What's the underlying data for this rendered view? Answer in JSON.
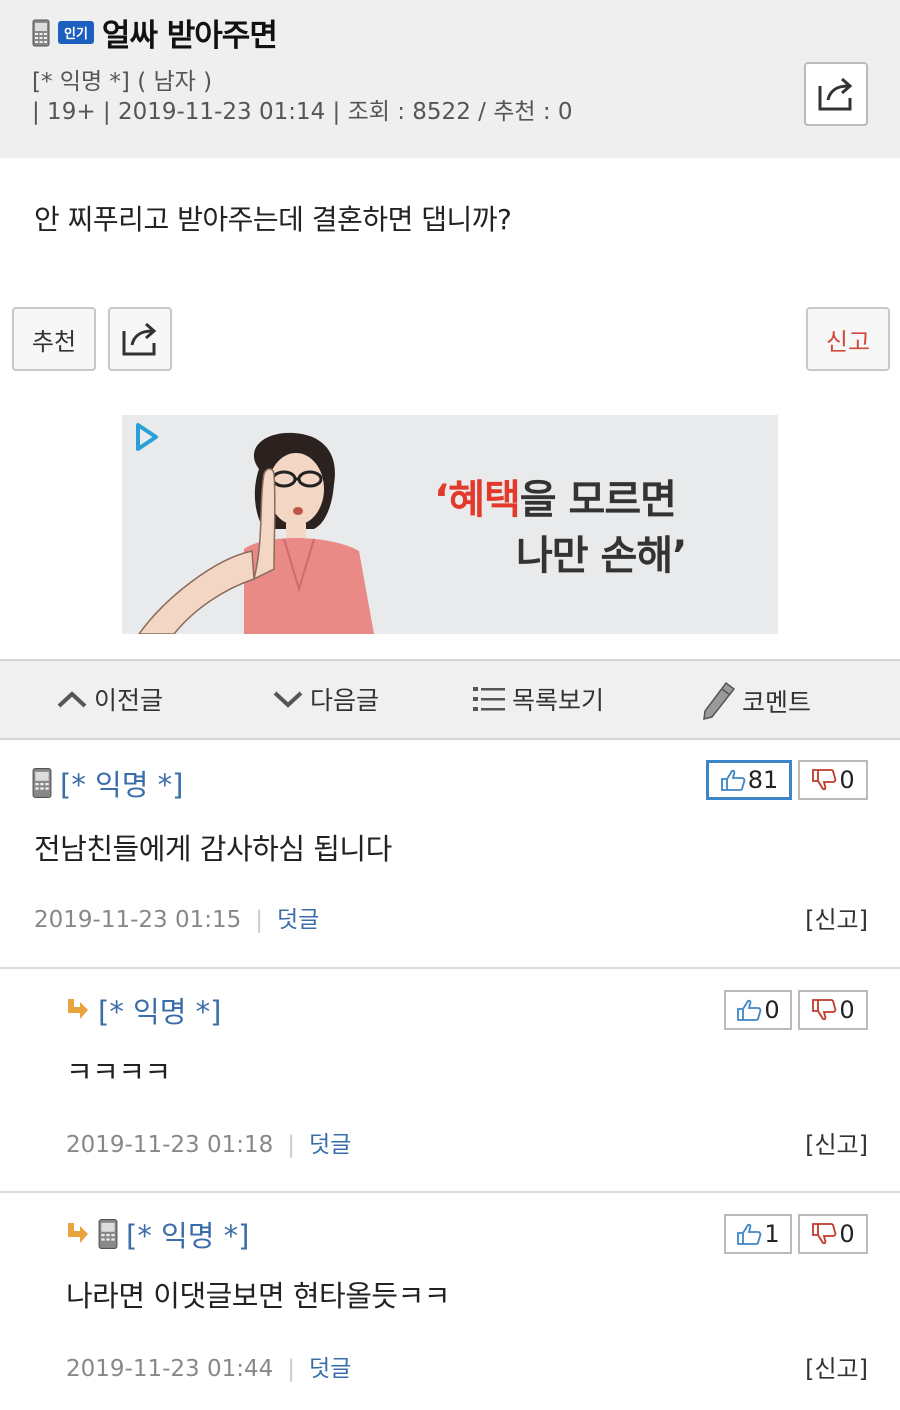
{
  "post": {
    "badge": "인기",
    "title": "얼싸 받아주면",
    "author_line": "[* 익명 *] ( 남자 )",
    "meta_line": "| 19+ | 2019-11-23 01:14 | 조회 : 8522 / 추천 : 0",
    "body": "안 찌푸리고 받아주는데 결혼하면 댑니까?"
  },
  "actions": {
    "recommend_label": "추천",
    "report_label": "신고"
  },
  "ad": {
    "line1_accent": "‘혜택",
    "line1_rest": "을 모르면",
    "line2": "나만 손해’"
  },
  "nav": {
    "prev": "이전글",
    "next": "다음글",
    "list": "목록보기",
    "comment": "코멘트"
  },
  "comments": [
    {
      "author": "[* 익명 *]",
      "text": "전남친들에게 감사하심 됩니다",
      "date": "2019-11-23 01:15",
      "reply": "덧글",
      "report": "[신고]",
      "likes": "81",
      "dislikes": "0"
    },
    {
      "author": "[* 익명 *]",
      "text": "ㅋㅋㅋㅋ",
      "date": "2019-11-23 01:18",
      "reply": "덧글",
      "report": "[신고]",
      "likes": "0",
      "dislikes": "0"
    },
    {
      "author": "[* 익명 *]",
      "text": "나라면 이댓글보면 현타올듯ㅋㅋ",
      "date": "2019-11-23 01:44",
      "reply": "덧글",
      "report": "[신고]",
      "likes": "1",
      "dislikes": "0"
    }
  ],
  "colors": {
    "accent_blue": "#3b6ea8",
    "badge_blue": "#1d5fbf",
    "report_red": "#d24a3c",
    "reply_arrow": "#e8a33d"
  }
}
